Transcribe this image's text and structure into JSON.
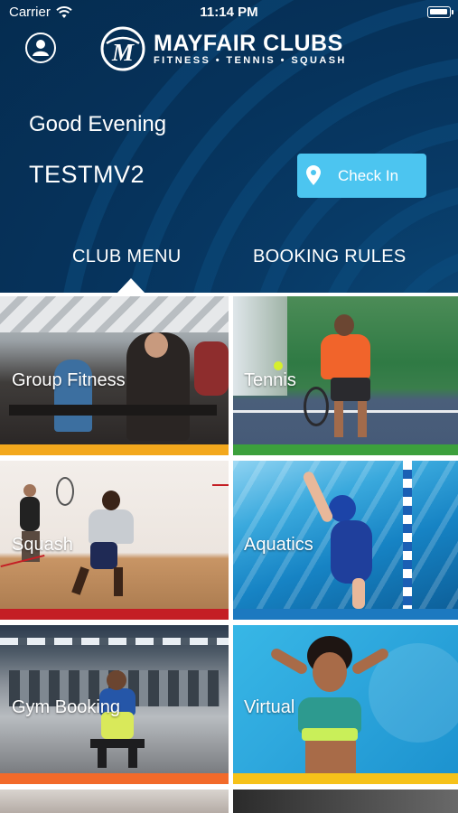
{
  "status_bar": {
    "carrier": "Carrier",
    "time": "11:14 PM"
  },
  "brand": {
    "name": "MAYFAIR CLUBS",
    "tagline": "FITNESS • TENNIS • SQUASH",
    "mark_letter": "M"
  },
  "greeting": "Good Evening",
  "user": {
    "name": "TESTMV2"
  },
  "check_in": {
    "label": "Check In"
  },
  "tabs": [
    {
      "label": "CLUB MENU",
      "active": true
    },
    {
      "label": "BOOKING RULES",
      "active": false
    }
  ],
  "menu": [
    {
      "label": "Group Fitness",
      "icon": "group-fitness-photo",
      "bar_color": "#f3a81d"
    },
    {
      "label": "Tennis",
      "icon": "tennis-photo",
      "bar_color": "#3ca03c"
    },
    {
      "label": "Squash",
      "icon": "squash-photo",
      "bar_color": "#c41e24"
    },
    {
      "label": "Aquatics",
      "icon": "aquatics-photo",
      "bar_color": "#1c79c0"
    },
    {
      "label": "Gym Booking",
      "icon": "gym-photo",
      "bar_color": "#f26a2a"
    },
    {
      "label": "Virtual",
      "icon": "virtual-photo",
      "bar_color": "#f6c21a"
    }
  ],
  "colors": {
    "header_bg": "#06335c",
    "accent": "#4cc5f0"
  }
}
